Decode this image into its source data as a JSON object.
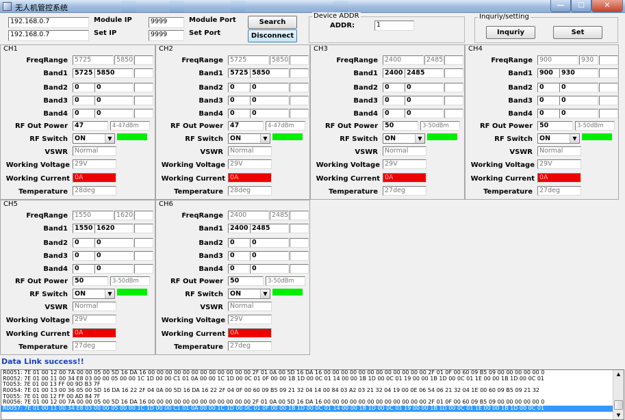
{
  "window": {
    "title": "无人机管控系统",
    "minimize": "—",
    "maximize": "☐",
    "close": "✕"
  },
  "connection": {
    "module_ip_label": "Module IP",
    "module_ip": "192.168.0.7",
    "set_ip_label": "Set IP",
    "set_ip": "192.168.0.7",
    "module_port_label": "Module Port",
    "module_port": "9999",
    "set_port_label": "Set Port",
    "set_port": "9999",
    "search_label": "Search",
    "disconnect_label": "Disconnect"
  },
  "device": {
    "group_title": "Device ADDR",
    "addr_label": "ADDR:",
    "addr": "1"
  },
  "inquiry": {
    "group_title": "Inquriy/setting",
    "inquiry_label": "Inquriy",
    "set_label": "Set"
  },
  "labels": {
    "freq_range": "FreqRange",
    "band1": "Band1",
    "band2": "Band2",
    "band3": "Band3",
    "band4": "Band4",
    "rf_out_power": "RF Out Power",
    "rf_switch": "RF Switch",
    "vswr": "VSWR",
    "working_voltage": "Working Voltage",
    "working_current": "Working Current",
    "temperature": "Temperature"
  },
  "channels": [
    {
      "title": "CH1",
      "freq": [
        "5725",
        "5850"
      ],
      "band1": [
        "5725",
        "5850"
      ],
      "band2": [
        "0",
        "0"
      ],
      "band3": [
        "0",
        "0"
      ],
      "band4": [
        "0",
        "0"
      ],
      "power": "47",
      "power_range": "4-47dBm",
      "switch": "ON",
      "vswr": "Normal",
      "voltage": "29V",
      "current": "0A",
      "temperature": "28deg"
    },
    {
      "title": "CH2",
      "freq": [
        "5725",
        "5850"
      ],
      "band1": [
        "5725",
        "5850"
      ],
      "band2": [
        "0",
        "0"
      ],
      "band3": [
        "0",
        "0"
      ],
      "band4": [
        "0",
        "0"
      ],
      "power": "47",
      "power_range": "4-47dBm",
      "switch": "ON",
      "vswr": "Normal",
      "voltage": "29V",
      "current": "0A",
      "temperature": "28deg"
    },
    {
      "title": "CH3",
      "freq": [
        "2400",
        "2485"
      ],
      "band1": [
        "2400",
        "2485"
      ],
      "band2": [
        "0",
        "0"
      ],
      "band3": [
        "0",
        "0"
      ],
      "band4": [
        "0",
        "0"
      ],
      "power": "50",
      "power_range": "3-50dBm",
      "switch": "ON",
      "vswr": "Normal",
      "voltage": "29V",
      "current": "0A",
      "temperature": "27deg"
    },
    {
      "title": "CH4",
      "freq": [
        "900",
        "930"
      ],
      "band1": [
        "900",
        "930"
      ],
      "band2": [
        "0",
        "0"
      ],
      "band3": [
        "0",
        "0"
      ],
      "band4": [
        "0",
        "0"
      ],
      "power": "50",
      "power_range": "3-50dBm",
      "switch": "ON",
      "vswr": "Normal",
      "voltage": "29V",
      "current": "0A",
      "temperature": "27deg"
    },
    {
      "title": "CH5",
      "freq": [
        "1550",
        "1620"
      ],
      "band1": [
        "1550",
        "1620"
      ],
      "band2": [
        "0",
        "0"
      ],
      "band3": [
        "0",
        "0"
      ],
      "band4": [
        "0",
        "0"
      ],
      "power": "50",
      "power_range": "3-50dBm",
      "switch": "ON",
      "vswr": "Normal",
      "voltage": "29V",
      "current": "0A",
      "temperature": "27deg"
    },
    {
      "title": "CH6",
      "freq": [
        "2400",
        "2485"
      ],
      "band1": [
        "2400",
        "2485"
      ],
      "band2": [
        "0",
        "0"
      ],
      "band3": [
        "0",
        "0"
      ],
      "band4": [
        "0",
        "0"
      ],
      "power": "50",
      "power_range": "3-50dBm",
      "switch": "ON",
      "vswr": "Normal",
      "voltage": "29V",
      "current": "0A",
      "temperature": "27deg"
    }
  ],
  "status_text": "Data Link success!!",
  "log": [
    "R0051: 7E 01 00 12 00 7A  00 00 05 00 5D 16 DA 16 00 00 00 00 00 00 00 00 00 00 00 00 2F 01 0A 00 5D 16 DA 16 00 00 00 00 00 00 00 00 00 00 00 00 2F 01 0F 00 60 09 B5 09 00 00 00 00 00 0",
    "R0052: 7E 01 00 11 00 34  E8 03 00 00 05 00 00 1C 1D 00 00 C1 01 0A 00 00 1C 1D 00 0C 01 0F 00 00 1B 1D 00 0C 01 14 00 00 1B 1D 00 0C 01 19 00 00 1B 1D 00 0C 01 1E 00 00 1B 1D 00 0C 01",
    "T0053: 7E 01 00 13 FF 00  9D B3 7F",
    "R0054: 7E 01 00 13 00 36  05 00 5D 16 DA 16 22 2F 04 0A 00 5D 16 DA 16 22 2F 04 0F 00 60 09 B5 09 21 32 04 14 00 84 03 A2 03 21 32 04 19 00 0E 06 54 06 21 32 04 1E 00 60 09 B5 09 21 32",
    "T0055: 7E 01 00 12 FF 00  AD 84 7F",
    "R0056: 7E 01 00 12 00 7A  00 00 05 00 5D 16 DA 16 00 00 00 00 00 00 00 00 00 00 00 00 2F 01 0A 00 5D 16 DA 16 00 00 00 00 00 00 00 00 00 00 00 00 2F 01 0F 00 60 09 B5 09 00 00 00 00 00 0",
    "R0057: 7E 01 00 11 00 34  E8 03 00 00 05 00 00 1C 1D 00 00 C1 01 0A 00 00 1C 1D 00 0C 01 0F 00 00 1B 1D 00 0C 01 14 00 00 1B 1D 00 0C 01 19 00 00 1B 1D 00 0C 01 1E 00 00 1B 1D 00 0C 01"
  ]
}
